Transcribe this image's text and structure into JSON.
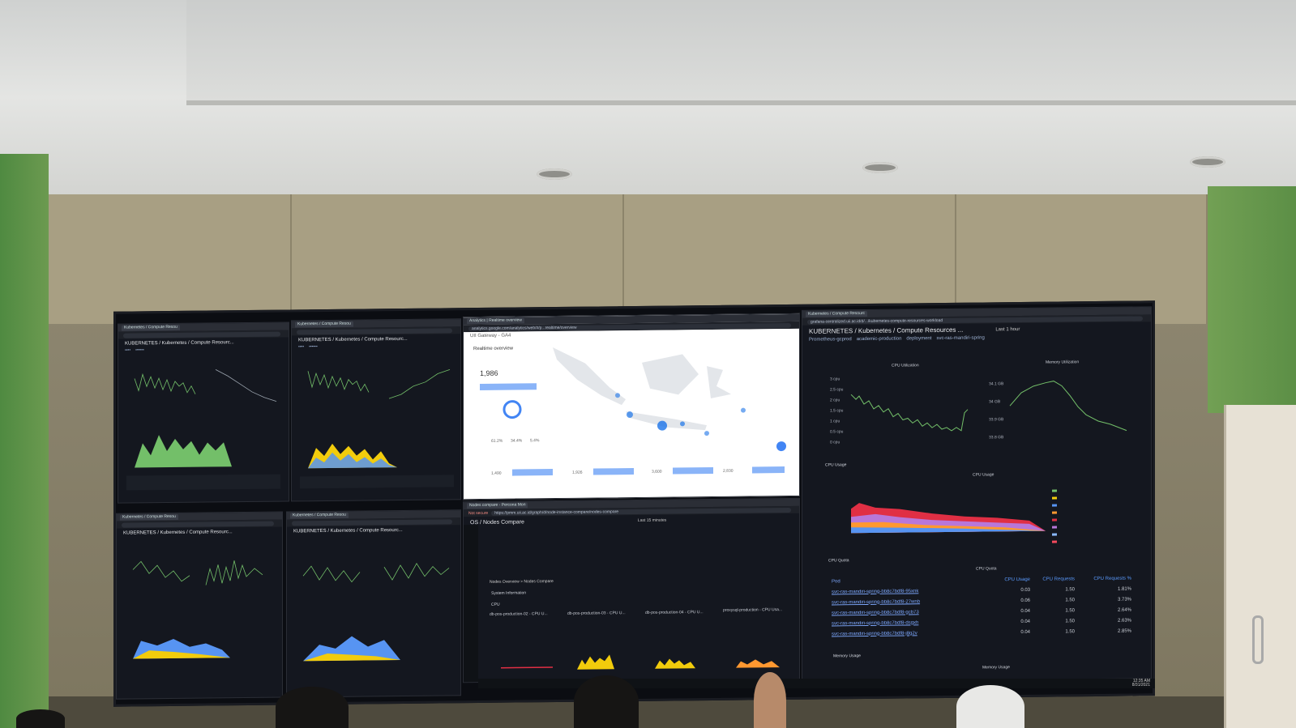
{
  "screens": {
    "top_left_1": {
      "tab": "Kubernetes / Compute Resou",
      "title": "KUBERNETES / Kubernetes / Compute Resourc..."
    },
    "top_left_2": {
      "tab": "Kubernetes / Compute Resou",
      "title": "KUBERNETES / Kubernetes / Compute Resourc..."
    },
    "bottom_left_1": {
      "tab": "Kubernetes / Compute Resou",
      "title": "KUBERNETES / Kubernetes / Compute Resourc..."
    },
    "bottom_left_2": {
      "tab": "Kubernetes / Compute Resou",
      "title": "KUBERNETES / Kubernetes / Compute Resourc..."
    },
    "analytics": {
      "tab": "Analytics | Realtime overview",
      "url": "analytics.google.com/analytics/web/#/p...realtime/overview",
      "property": "UII Gateway - GA4",
      "page_title": "Realtime overview",
      "users_count": "1,986",
      "pct_1": "61.2%",
      "pct_2": "34.4%",
      "pct_3": "5.4%",
      "card_1": "1,490",
      "card_2": "1,926",
      "card_3": "3,600",
      "card_4": "2,830"
    },
    "nodes_compare": {
      "tab": "Nodes compare - Percona Mon",
      "not_secure": "Not secure",
      "url": "https://pmm.uii.ac.id/graph/d/node-instance-compare/nodes-compare",
      "title": "OS / Nodes Compare",
      "time_range": "Last 15 minutes",
      "breadcrumb_1": "Nodes Overview",
      "breadcrumb_2": "Nodes Compare",
      "row_system": "System Information",
      "row_cpu": "CPU",
      "panel_1": "db-pos-production-02 - CPU U...",
      "panel_2": "db-pos-production-03 - CPU U...",
      "panel_3": "db-pos-production-04 - CPU U...",
      "panel_4": "proxysql-production - CPU Usa..."
    },
    "k8s_right": {
      "tab": "Kubernetes / Compute Resourc",
      "url": "grafana-centralized.uii.ac.id/d/.../kubernetes-compute-resources-workload",
      "title": "KUBERNETES / Kubernetes / Compute Resources ...",
      "time_range": "Last 1 hour",
      "var_datasource": "Prometheus-gcprod",
      "var_namespace": "academic-production",
      "var_type": "deployment",
      "var_workload": "svc-ras-mandiri-spring",
      "cpu_util_title": "CPU Utilization",
      "mem_util_title": "Memory Utilization",
      "row_cpu_usage": "CPU Usage",
      "cpu_usage_title": "CPU Usage",
      "row_cpu_quota": "CPU Quota",
      "cpu_quota_title": "CPU Quota",
      "row_memory": "Memory Usage",
      "memory_title": "Memory Usage",
      "columns": [
        "Pod",
        "CPU Usage",
        "CPU Requests",
        "CPU Requests %"
      ],
      "rows": [
        [
          "svc-ras-mandiri-spring-bb8c7bdf8-95xnk",
          "0.03",
          "1.50",
          "1.81%"
        ],
        [
          "svc-ras-mandiri-spring-bb8c7bdf8-27wnb",
          "0.06",
          "1.50",
          "3.73%"
        ],
        [
          "svc-ras-mandiri-spring-bb8c7bdf8-gcb73",
          "0.04",
          "1.50",
          "2.64%"
        ],
        [
          "svc-ras-mandiri-spring-bb8c7bdf8-dsgxh",
          "0.04",
          "1.50",
          "2.63%"
        ],
        [
          "svc-ras-mandiri-spring-bb8c7bdf8-j8g2v",
          "0.04",
          "1.50",
          "2.85%"
        ]
      ],
      "mem_ticks": [
        "34.1 GB",
        "34 GB",
        "33.9 GB",
        "33.8 GB"
      ],
      "cpu_ticks": [
        "3 cpu",
        "2.5 cpu",
        "2 cpu",
        "1.5 cpu",
        "1 cpu",
        "0.5 cpu",
        "0 cpu"
      ]
    }
  },
  "clock": {
    "time": "12:35 AM",
    "date": "8/31/2021"
  }
}
